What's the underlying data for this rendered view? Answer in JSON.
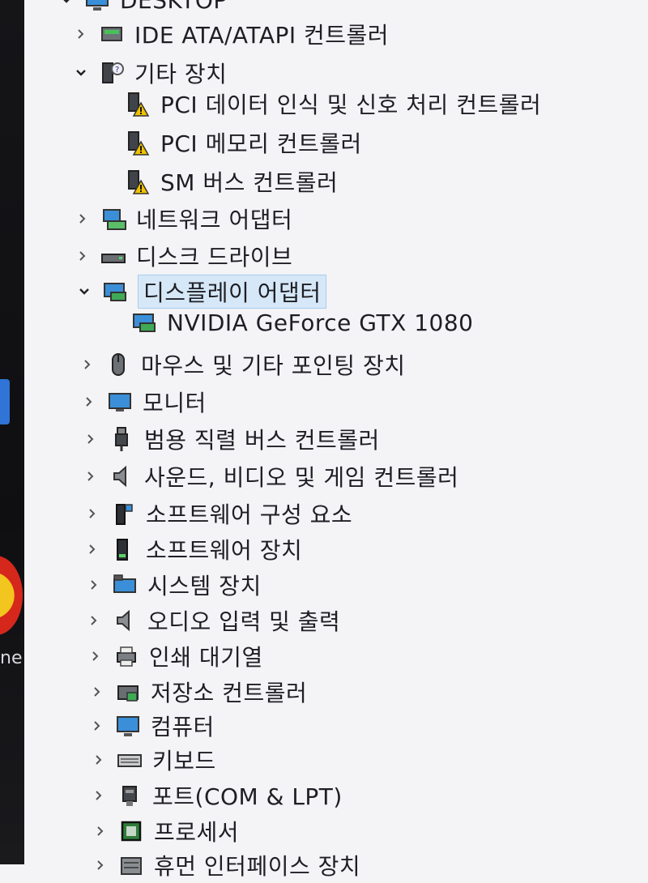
{
  "tree": {
    "root_label": "DESKTOP",
    "items": [
      {
        "label": "IDE ATA/ATAPI 컨트롤러",
        "icon": "ide-controller-icon",
        "state": "collapsed"
      },
      {
        "label": "기타 장치",
        "icon": "other-devices-icon",
        "state": "expanded"
      },
      {
        "label": "PCI 데이터 인식 및 신호 처리 컨트롤러",
        "icon": "unknown-device-warning-icon",
        "state": "child"
      },
      {
        "label": "PCI 메모리 컨트롤러",
        "icon": "unknown-device-warning-icon",
        "state": "child"
      },
      {
        "label": "SM 버스 컨트롤러",
        "icon": "unknown-device-warning-icon",
        "state": "child"
      },
      {
        "label": "네트워크 어댑터",
        "icon": "network-adapter-icon",
        "state": "collapsed"
      },
      {
        "label": "디스크 드라이브",
        "icon": "disk-drive-icon",
        "state": "collapsed"
      },
      {
        "label": "디스플레이 어댑터",
        "icon": "display-adapter-icon",
        "state": "expanded",
        "selected": true
      },
      {
        "label": "NVIDIA GeForce GTX 1080",
        "icon": "display-adapter-icon",
        "state": "child"
      },
      {
        "label": "마우스 및 기타 포인팅 장치",
        "icon": "mouse-icon",
        "state": "collapsed"
      },
      {
        "label": "모니터",
        "icon": "monitor-icon",
        "state": "collapsed"
      },
      {
        "label": "범용 직렬 버스 컨트롤러",
        "icon": "usb-controller-icon",
        "state": "collapsed"
      },
      {
        "label": "사운드, 비디오 및 게임 컨트롤러",
        "icon": "speaker-icon",
        "state": "collapsed"
      },
      {
        "label": "소프트웨어 구성 요소",
        "icon": "software-component-icon",
        "state": "collapsed"
      },
      {
        "label": "소프트웨어 장치",
        "icon": "software-device-icon",
        "state": "collapsed"
      },
      {
        "label": "시스템 장치",
        "icon": "system-device-icon",
        "state": "collapsed"
      },
      {
        "label": "오디오 입력 및 출력",
        "icon": "speaker-icon",
        "state": "collapsed"
      },
      {
        "label": "인쇄 대기열",
        "icon": "printer-icon",
        "state": "collapsed"
      },
      {
        "label": "저장소 컨트롤러",
        "icon": "storage-controller-icon",
        "state": "collapsed"
      },
      {
        "label": "컴퓨터",
        "icon": "computer-icon",
        "state": "collapsed"
      },
      {
        "label": "키보드",
        "icon": "keyboard-icon",
        "state": "collapsed"
      },
      {
        "label": "포트(COM & LPT)",
        "icon": "port-icon",
        "state": "collapsed"
      },
      {
        "label": "프로세서",
        "icon": "processor-icon",
        "state": "collapsed"
      },
      {
        "label": "휴먼 인터페이스 장치",
        "icon": "hid-icon",
        "state": "collapsed"
      }
    ]
  },
  "side_panel": {
    "partial_text": "ne"
  },
  "colors": {
    "selection": "#d6e8f8",
    "selection_border": "#a8cdee",
    "text": "#1e1e24",
    "warning": "#f2c200"
  }
}
